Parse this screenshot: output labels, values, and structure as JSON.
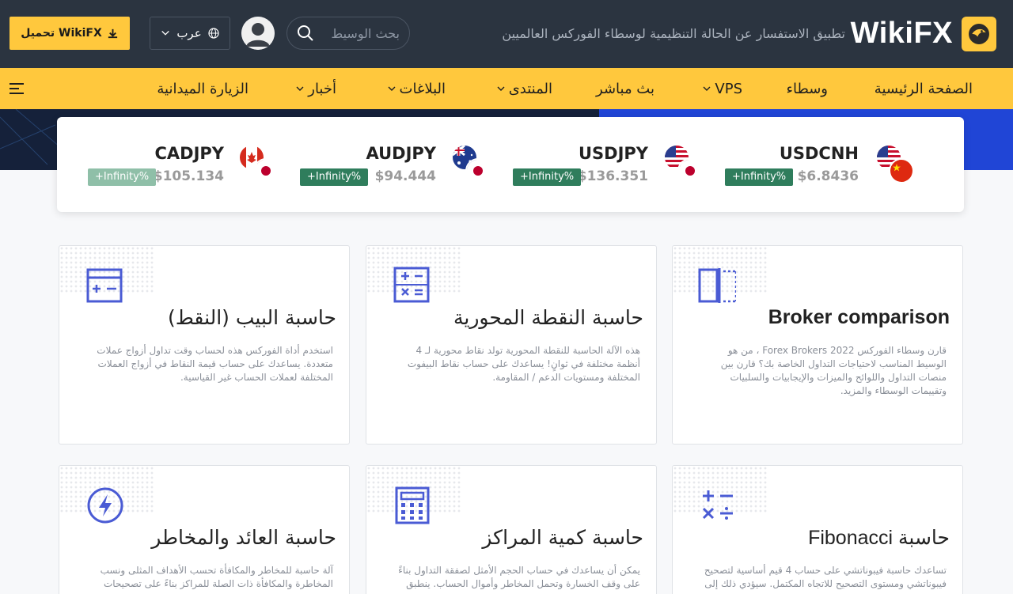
{
  "header": {
    "download_label": "تحميل WikiFX",
    "language_label": "عرب",
    "search_placeholder": "بحث الوسيط",
    "tagline": "تطبيق الاستفسار عن الحالة التنظيمية لوسطاء الفوركس العالميين",
    "brand": "WikiFX",
    "colors": {
      "header_bg": "#2b3440",
      "accent": "#ffc83d"
    }
  },
  "nav": {
    "items": [
      {
        "label": "الصفحة الرئيسية",
        "dropdown": false
      },
      {
        "label": "وسطاء",
        "dropdown": false
      },
      {
        "label": "VPS",
        "dropdown": true
      },
      {
        "label": "بث مباشر",
        "dropdown": false
      },
      {
        "label": "المنتدى",
        "dropdown": true
      },
      {
        "label": "البلاغات",
        "dropdown": true
      },
      {
        "label": "أخبار",
        "dropdown": true
      },
      {
        "label": "الزيارة الميدانية",
        "dropdown": false
      }
    ]
  },
  "quotes": [
    {
      "symbol": "USDCNH",
      "price": "$6.8436",
      "change": "+Infinity%",
      "flags": [
        "us-flag",
        "cn-flag"
      ]
    },
    {
      "symbol": "USDJPY",
      "price": "$136.351",
      "change": "+Infinity%",
      "flags": [
        "us-flag",
        "jp-flag"
      ]
    },
    {
      "symbol": "AUDJPY",
      "price": "$94.444",
      "change": "+Infinity%",
      "flags": [
        "au-flag",
        "jp-flag"
      ]
    },
    {
      "symbol": "CADJPY",
      "price": "$105.134",
      "change": "+Infinity%",
      "flags": [
        "ca-flag",
        "jp-flag"
      ]
    }
  ],
  "tools": [
    {
      "title": "Broker comparison",
      "icon": "compare-icon",
      "desc": "قارن وسطاء الفوركس Forex Brokers 2022 ، من هو الوسيط المناسب لاحتياجات التداول الخاصة بك؟ قارن بين منصات التداول واللوائح والميزات والإيجابيات والسلبيات وتقييمات الوسطاء والمزيد."
    },
    {
      "title": "حاسبة النقطة المحورية",
      "icon": "calculator-ops-icon",
      "desc": "هذه الآلة الحاسبة للنقطة المحورية تولد نقاط محورية لـ 4 أنظمة مختلفة في ثوانٍ! يساعدك على حساب نقاط البيفوت المختلفة ومستويات الدعم / المقاومة."
    },
    {
      "title": "حاسبة البيب (النقط)",
      "icon": "pip-calculator-icon",
      "desc": "استخدم أداة الفوركس هذه لحساب وقت تداول أزواج عملات متعددة. يساعدك على حساب قيمة النقاط في أزواج العملات المختلفة لعملات الحساب غير القياسية."
    },
    {
      "title": "حاسبة Fibonacci",
      "icon": "fibonacci-icon",
      "desc": "تساعدك حاسبة فيبوناتشي على حساب 4 قيم أساسية لتصحيح فيبوناتشي ومستوى التصحيح للاتجاه المكتمل. سيؤدي ذلك إلى"
    },
    {
      "title": "حاسبة كمية المراكز",
      "icon": "position-calculator-icon",
      "desc": "يمكن أن يساعدك في حساب الحجم الأمثل لصفقة التداول بناءً على وقف الخسارة وتحمل المخاطر وأموال الحساب. ينطبق"
    },
    {
      "title": "حاسبة العائد والمخاطر",
      "icon": "lightning-icon",
      "desc": "آلة حاسبة للمخاطر والمكافأة تحسب الأهداف المثلى ونسب المخاطرة والمكافأة ذات الصلة للمراكز بناءً على تصحيحات"
    }
  ]
}
